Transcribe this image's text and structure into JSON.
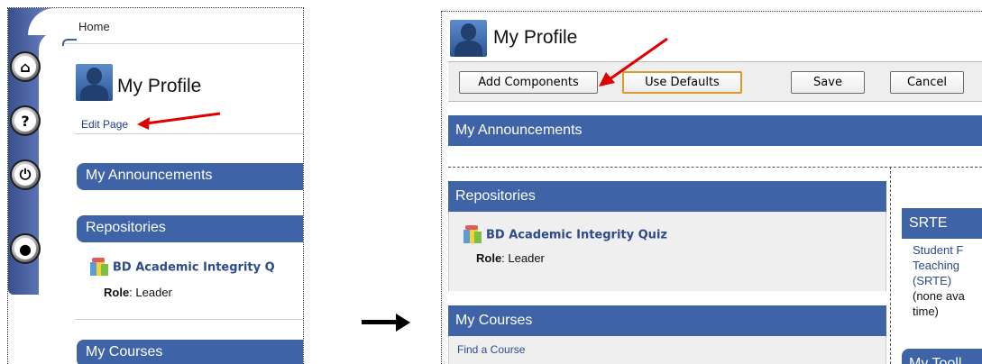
{
  "colors": {
    "accent_blue": "#3e63a6",
    "link_blue": "#2c4a8c",
    "annotation_red": "#e00000",
    "highlight_orange": "#d89a2a"
  },
  "left_panel": {
    "nav": {
      "home_label": "Home"
    },
    "rail_icons": [
      "home-icon",
      "help-icon",
      "power-icon",
      "user-silhouette-icon"
    ],
    "rail_glyphs": {
      "home": "⌂",
      "help": "?",
      "power": "⏻",
      "user": "●"
    },
    "page_title": "My Profile",
    "edit_page_label": "Edit Page",
    "modules": {
      "announcements": "My Announcements",
      "repositories": "Repositories",
      "courses": "My Courses"
    },
    "repo_item": {
      "name": "BD Academic Integrity Q",
      "role_label": "Role",
      "role_value": ": Leader"
    }
  },
  "right_panel": {
    "page_title": "My Profile",
    "toolbar": {
      "add_components": "Add Components",
      "use_defaults": "Use Defaults",
      "save": "Save",
      "cancel": "Cancel"
    },
    "announcements_title": "My Announcements",
    "left_column": {
      "repositories_title": "Repositories",
      "repo_item_name": "BD Academic Integrity Quiz",
      "role_label": "Role",
      "role_value": ": Leader",
      "courses_title": "My Courses",
      "find_course": "Find a Course"
    },
    "right_column": {
      "srte_title": "SRTE",
      "srte_link_lines": [
        "Student F",
        "Teaching",
        "(SRTE)"
      ],
      "srte_note_lines": [
        "(none ava",
        "time)"
      ],
      "tools_title": "My Tooll"
    }
  }
}
